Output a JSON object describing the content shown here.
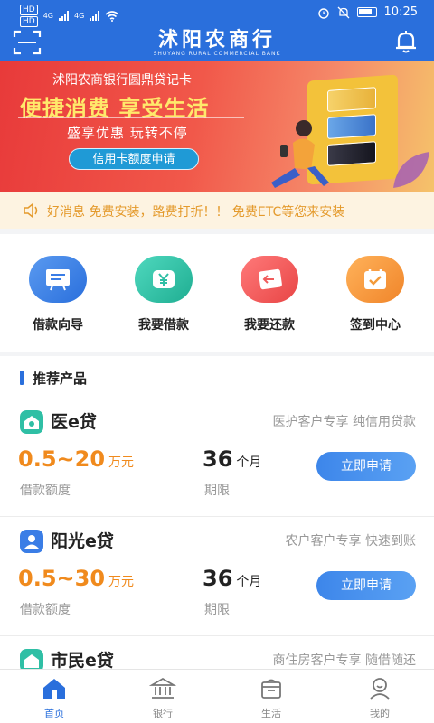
{
  "status_bar": {
    "hd1": "HD",
    "hd2": "HD",
    "net1": "4G",
    "net2": "4G",
    "time": "10:25"
  },
  "header": {
    "logo_cn": "沭阳农商行",
    "logo_en": "SHUYANG RURAL COMMERCIAL BANK"
  },
  "banner": {
    "title": "沭阳农商银行圆鼎贷记卡",
    "slogan": "便捷消费 享受生活",
    "subtitle": "盛享优惠  玩转不停",
    "button": "信用卡额度申请"
  },
  "notice": {
    "text": "好消息 免费安装，路费打折！！ 免费ETC等您来安装"
  },
  "quick_entries": [
    {
      "label": "借款向导",
      "icon": "loan-guide-icon",
      "color": "#3a7de6"
    },
    {
      "label": "我要借款",
      "icon": "yuan-icon",
      "color": "#2fbfa5"
    },
    {
      "label": "我要还款",
      "icon": "repay-icon",
      "color": "#f05b5b"
    },
    {
      "label": "签到中心",
      "icon": "calendar-check-icon",
      "color": "#f39a3a"
    }
  ],
  "products": {
    "section_title": "推荐产品",
    "items": [
      {
        "name": "医e贷",
        "tag": "医护客户专享 纯信用贷款",
        "amount": "0.5~20",
        "amount_unit": "万元",
        "amount_label": "借款额度",
        "term": "36",
        "term_unit": "个月",
        "term_label": "期限",
        "button": "立即申请",
        "icon": "doctor-icon",
        "color": "#2fbfa5"
      },
      {
        "name": "阳光e贷",
        "tag": "农户客户专享 快速到账",
        "amount": "0.5~30",
        "amount_unit": "万元",
        "amount_label": "借款额度",
        "term": "36",
        "term_unit": "个月",
        "term_label": "期限",
        "button": "立即申请",
        "icon": "farmer-icon",
        "color": "#3a7de6"
      },
      {
        "name": "市民e贷",
        "tag": "商住房客户专享 随借随还",
        "icon": "citizen-icon",
        "color": "#2fbfa5"
      }
    ]
  },
  "tab_bar": [
    {
      "label": "首页",
      "icon": "home-icon",
      "active": true
    },
    {
      "label": "银行",
      "icon": "bank-icon",
      "active": false
    },
    {
      "label": "生活",
      "icon": "shopping-bag-icon",
      "active": false
    },
    {
      "label": "我的",
      "icon": "profile-icon",
      "active": false
    }
  ]
}
